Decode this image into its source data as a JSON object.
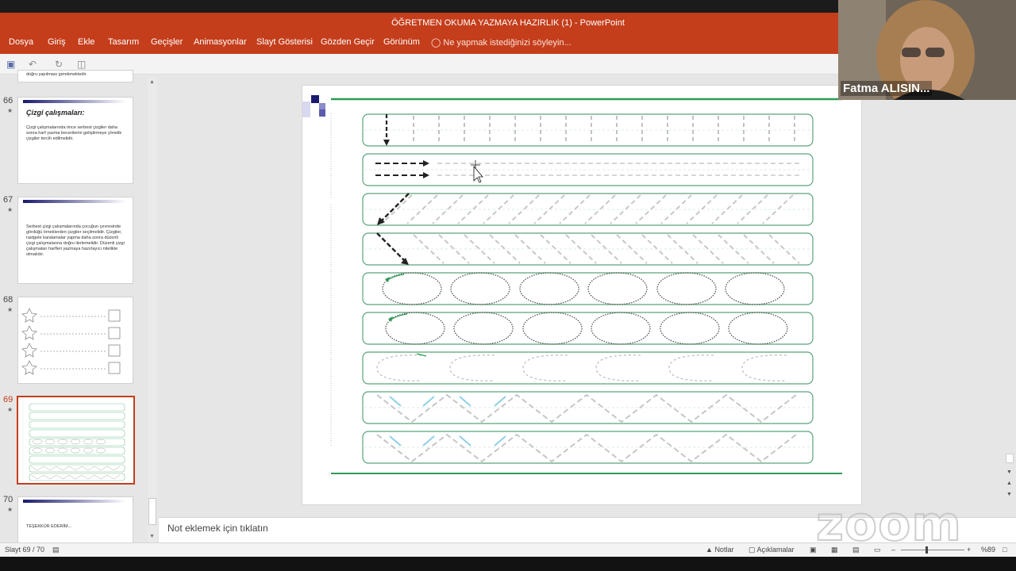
{
  "window": {
    "title": "ÖĞRETMEN OKUMA YAZMAYA HAZIRLIK (1) - PowerPoint"
  },
  "ribbon": {
    "tabs": [
      "Dosya",
      "Giriş",
      "Ekle",
      "Tasarım",
      "Geçişler",
      "Animasyonlar",
      "Slayt Gösterisi",
      "Gözden Geçir",
      "Görünüm"
    ],
    "tell_me": "Ne yapmak istediğinizi söyleyin..."
  },
  "thumbnails": [
    {
      "num": "66",
      "title": "Çizgi çalışmaları:",
      "text": "Çizgi çalışmalarında önce serbest çizgiler daha sonra harf yazma becerilerini geliştirmeye yönelik çizgiler tercih edilmelidir."
    },
    {
      "num": "67",
      "title": "",
      "text": "Serbest çizgi çalışmalarında çocuğun çevresinde gördüğü örneklerden çizgiler seçilmelidir. Çizgiler, rastgele karalamalar yapma daha sonra düzenli çizgi çalışmalarına doğru ilerlemelidir. Düzenli çizgi çalışmaları harfleri yazmaya hazırlayıcı nitelikte olmalıdır."
    },
    {
      "num": "68",
      "title": "",
      "text": ""
    },
    {
      "num": "69",
      "title": "",
      "text": "",
      "selected": true
    },
    {
      "num": "70",
      "title": "",
      "text": "TEŞEKKÜR EDERİM..."
    }
  ],
  "top_snippet": "doğru yapılması gerekmektedir.",
  "notes_placeholder": "Not eklemek için tıklatın",
  "status": {
    "slide": "Slayt 69 / 70",
    "notes": "Notlar",
    "comments": "Açıklamalar",
    "zoom": "%89"
  },
  "video": {
    "name": "Fatma ALISIN..."
  },
  "zoom_logo": "zoom",
  "colors": {
    "accent": "#c43e1c",
    "guide_green": "#5aa57a",
    "trace_gray": "#bdbdbd",
    "arrow_blue": "#8fd0e6"
  }
}
